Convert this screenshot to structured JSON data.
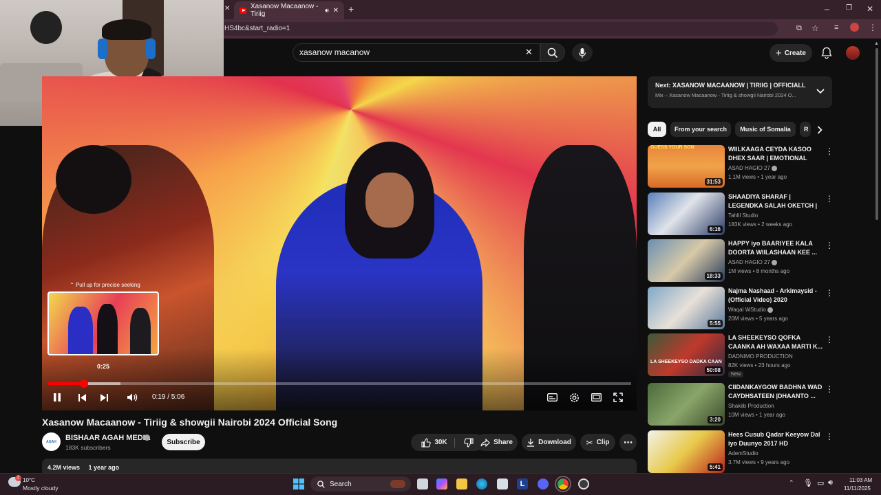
{
  "browser": {
    "tab_title": "Xasanow Macaanow - Tiriig",
    "url_fragment": "HS4bc&start_radio=1"
  },
  "header": {
    "search_value": "xasanow macanow",
    "create_label": "Create"
  },
  "player": {
    "seek_hint": "Pull up for precise seeking",
    "preview_time": "0:25",
    "current_time": "0:19",
    "duration": "5:06",
    "time_display": "0:19 / 5:06",
    "progress_played_fraction": 0.062,
    "progress_buffered_fraction": 0.125
  },
  "video": {
    "title": "Xasanow Macaanow - Tiriig & showgii Nairobi 2024 Official Song",
    "channel_name": "BISHAAR AGAH MEDIA",
    "channel_avatar_text": "AGAH",
    "subscribers": "183K subscribers",
    "subscribe_label": "Subscribe",
    "like_count": "30K",
    "share_label": "Share",
    "download_label": "Download",
    "clip_label": "Clip",
    "views": "4.2M views",
    "uploaded": "1 year ago"
  },
  "sidebar": {
    "next_title": "Next: XASANOW MACAANOW | TIRIIG | OFFICIALL ...",
    "next_sub": "Mix – Xasanow Macaanow - Tiriig & showgii Nairobi 2024 O...",
    "chips": [
      "All",
      "From your search",
      "Music of Somalia",
      "R"
    ],
    "recommendations": [
      {
        "title": "WIILKAAGA CEYDA KASOO DHEX SAAR | EMOTIONAL",
        "channel": "ASAD HAGIO 27",
        "meta": "1.1M views • 1 year ago",
        "duration": "31:53",
        "thumb_text": "GUESS YOUR SON",
        "badge": ""
      },
      {
        "title": "SHAADIYA SHARAF | LEGENDKA SALAH OKETCH | ...",
        "channel": "Tahlil Studio",
        "meta": "183K views • 2 weeks ago",
        "duration": "6:16",
        "thumb_text": "",
        "badge": ""
      },
      {
        "title": "HAPPY iyo BAARIYEE KALA DOORTA WIILASHAAN KEE ...",
        "channel": "ASAD HAGIO 27",
        "meta": "1M views • 8 months ago",
        "duration": "18:33",
        "thumb_text": "",
        "badge": ""
      },
      {
        "title": "Najma Nashaad - Arkimaysid - (Official Video) 2020",
        "channel": "Waqal WStudio",
        "meta": "20M views • 5 years ago",
        "duration": "5:55",
        "thumb_text": "",
        "badge": ""
      },
      {
        "title": "LA SHEEKEYSO QOFKA CAANKA AH WAXAA MARTI K...",
        "channel": "DADNIMO PRODUCTION",
        "meta": "82K views • 23 hours ago",
        "duration": "50:08",
        "thumb_text": "LA SHEEKEYSO DADKA CAAN",
        "badge": "New"
      },
      {
        "title": "CIIDANKAYGOW BADHNA WAD CAYDHSATEEN |DHAANTO ...",
        "channel": "Shakiib Production",
        "meta": "10M views • 1 year ago",
        "duration": "3:20",
        "thumb_text": "",
        "badge": ""
      },
      {
        "title": "Hees Cusub Qadar Keeyow Dal iyo Duunyo 2017 HD",
        "channel": "AdemStudio",
        "meta": "3.7M views • 9 years ago",
        "duration": "5:41",
        "thumb_text": "",
        "badge": ""
      }
    ]
  },
  "taskbar": {
    "weather_temp": "10°C",
    "weather_desc": "Mostly cloudy",
    "search_label": "Search",
    "time": "11:03 AM",
    "date": "11/11/2025"
  },
  "colors": {
    "accent_red": "#ff0000",
    "bg": "#0f0f0f",
    "chip_bg": "#272727"
  }
}
